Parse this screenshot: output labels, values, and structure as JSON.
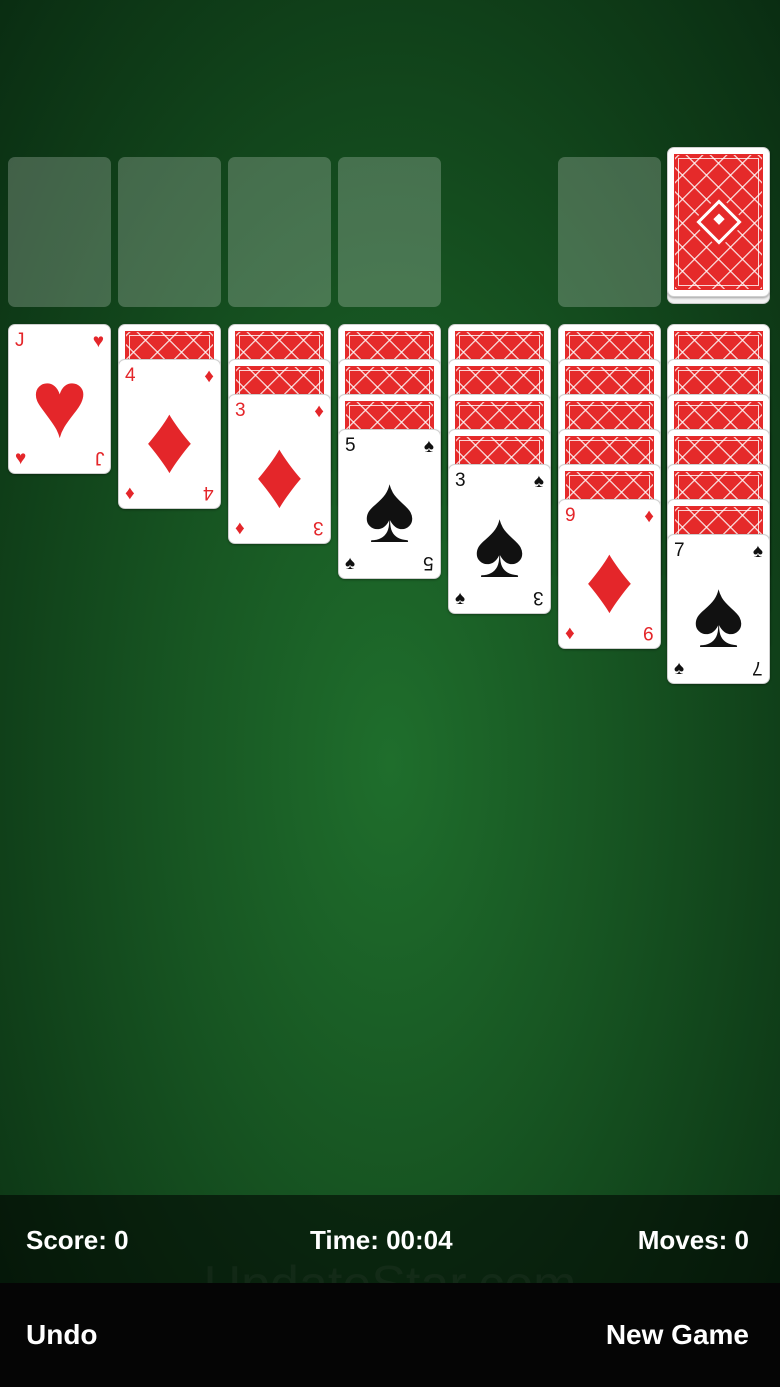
{
  "colors": {
    "felt": "#175522",
    "card_back": "#e52a2a",
    "red_suit": "#e4262a",
    "black_suit": "#111111"
  },
  "foundations": [
    {
      "state": "empty"
    },
    {
      "state": "empty"
    },
    {
      "state": "empty"
    },
    {
      "state": "empty"
    }
  ],
  "waste": {
    "state": "empty"
  },
  "stock": {
    "state": "face-down",
    "icon": "diamond-back-icon"
  },
  "tableau": [
    {
      "facedown": 0,
      "card": {
        "rank": "J",
        "suit": "♥",
        "color": "red",
        "name": "jack-of-hearts"
      }
    },
    {
      "facedown": 1,
      "card": {
        "rank": "4",
        "suit": "♦",
        "color": "red",
        "name": "four-of-diamonds"
      }
    },
    {
      "facedown": 2,
      "card": {
        "rank": "3",
        "suit": "♦",
        "color": "red",
        "name": "three-of-diamonds"
      }
    },
    {
      "facedown": 3,
      "card": {
        "rank": "5",
        "suit": "♠",
        "color": "black",
        "name": "five-of-spades"
      }
    },
    {
      "facedown": 4,
      "card": {
        "rank": "3",
        "suit": "♠",
        "color": "black",
        "name": "three-of-spades"
      }
    },
    {
      "facedown": 5,
      "card": {
        "rank": "9",
        "suit": "♦",
        "color": "red",
        "name": "nine-of-diamonds"
      }
    },
    {
      "facedown": 6,
      "card": {
        "rank": "7",
        "suit": "♠",
        "color": "black",
        "name": "seven-of-spades"
      }
    }
  ],
  "status": {
    "score": "Score: 0",
    "time": "Time: 00:04",
    "moves": "Moves: 0"
  },
  "controls": {
    "undo": "Undo",
    "new_game": "New Game"
  },
  "watermark": "UpdateStar.com"
}
